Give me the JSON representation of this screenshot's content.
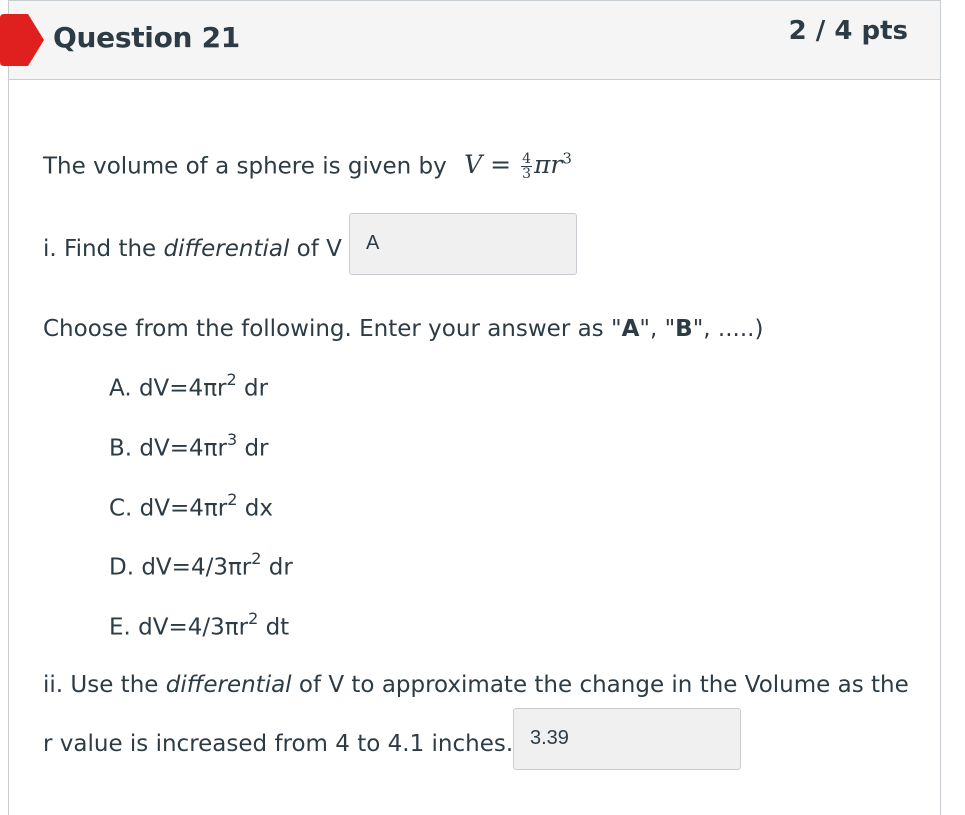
{
  "header": {
    "title": "Question 21",
    "points": "2 / 4 pts",
    "flag_color": "#e0201e"
  },
  "question": {
    "intro": "The volume of a sphere is given by",
    "formula": {
      "lhs": "V",
      "equals": "=",
      "numerator": "4",
      "denominator": "3",
      "rhs": "πr",
      "exponent": "3"
    },
    "part1": {
      "prefix": "i. Find the ",
      "emph": "differential",
      "suffix": " of V",
      "answer": "A"
    },
    "instructions": {
      "text_before": "Choose from the following.  Enter your answer as \"",
      "a": "A",
      "mid": "\", \"",
      "b": "B",
      "text_after": "\", .....)"
    },
    "options": [
      {
        "base": "A. dV=4πr",
        "exp": "2",
        "tail": " dr"
      },
      {
        "base": "B. dV=4πr",
        "exp": "3",
        "tail": " dr"
      },
      {
        "base": "C. dV=4πr",
        "exp": "2",
        "tail": " dx"
      },
      {
        "base": "D. dV=4/3πr",
        "exp": "2",
        "tail": " dr"
      },
      {
        "base": "E. dV=4/3πr",
        "exp": "2",
        "tail": " dt"
      }
    ],
    "part2": {
      "prefix": "ii. Use the ",
      "emph": "differential",
      "suffix": " of V to approximate the change in the Volume as the",
      "line2": "r value is increased from 4 to 4.1 inches.",
      "answer": "3.39"
    }
  }
}
